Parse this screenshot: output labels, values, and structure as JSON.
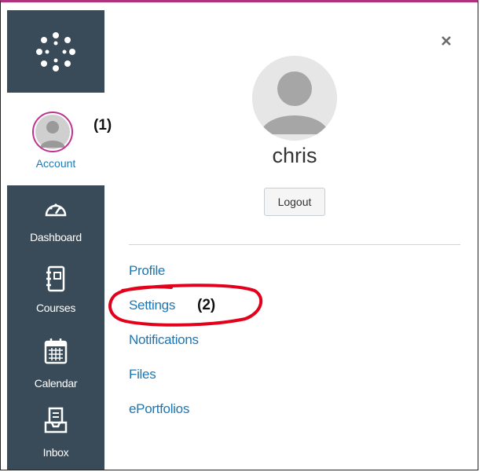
{
  "sidebar": {
    "logo_icon": "canvas-logo-icon",
    "account": {
      "label": "Account",
      "icon": "avatar-icon"
    },
    "items": [
      {
        "label": "Dashboard",
        "icon": "speedometer-icon"
      },
      {
        "label": "Courses",
        "icon": "book-icon"
      },
      {
        "label": "Calendar",
        "icon": "calendar-icon"
      },
      {
        "label": "Inbox",
        "icon": "inbox-icon"
      }
    ]
  },
  "annotations": {
    "account": "(1)",
    "settings": "(2)"
  },
  "panel": {
    "user_name": "chris",
    "logout_label": "Logout",
    "close_icon": "close-icon",
    "links": [
      "Profile",
      "Settings",
      "Notifications",
      "Files",
      "ePortfolios"
    ]
  },
  "colors": {
    "sidebar": "#394b58",
    "accent": "#c0338d",
    "link": "#1a77b5",
    "highlight": "#e3001b"
  }
}
